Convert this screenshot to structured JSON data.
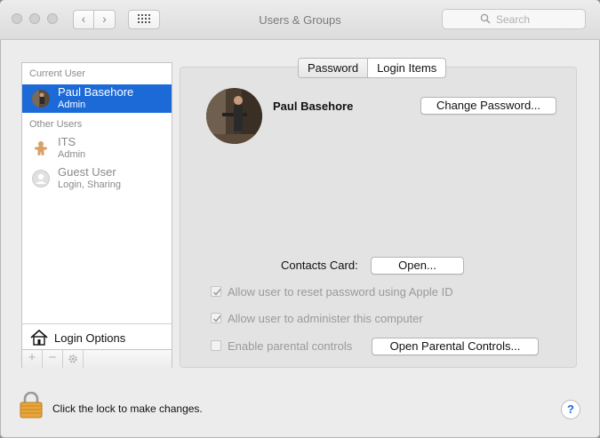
{
  "window": {
    "title": "Users & Groups",
    "search_placeholder": "Search",
    "nav_back": "‹",
    "nav_forward": "›"
  },
  "sidebar": {
    "current_user_label": "Current User",
    "other_users_label": "Other Users",
    "users": [
      {
        "name": "Paul Basehore",
        "role": "Admin",
        "selected": true
      },
      {
        "name": "ITS",
        "role": "Admin",
        "selected": false
      },
      {
        "name": "Guest User",
        "role": "Login, Sharing",
        "selected": false
      }
    ],
    "login_options_label": "Login Options",
    "add_symbol": "+",
    "remove_symbol": "−"
  },
  "tabs": [
    {
      "label": "Password",
      "active": true
    },
    {
      "label": "Login Items",
      "active": false
    }
  ],
  "detail": {
    "user_name": "Paul Basehore",
    "change_password_label": "Change Password...",
    "contacts_card_label": "Contacts Card:",
    "open_label": "Open...",
    "checkboxes": [
      {
        "label": "Allow user to reset password using Apple ID",
        "checked": true
      },
      {
        "label": "Allow user to administer this computer",
        "checked": true
      },
      {
        "label": "Enable parental controls",
        "checked": false
      }
    ],
    "open_parental_controls_label": "Open Parental Controls..."
  },
  "footer": {
    "lock_text": "Click the lock to make changes.",
    "help_symbol": "?"
  },
  "colors": {
    "selection": "#1b6ad8",
    "lock": "#e7a53b"
  }
}
